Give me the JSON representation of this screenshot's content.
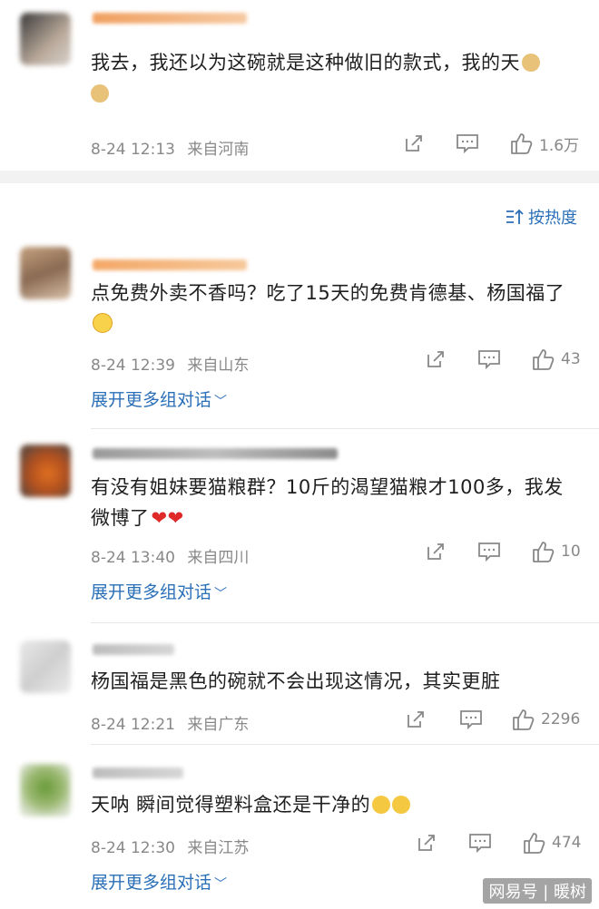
{
  "sort": {
    "label": "按热度"
  },
  "comments": [
    {
      "text": "我去，我还以为这碗就是这种做旧的款式，我的天",
      "time": "8-24 12:13",
      "location": "来自河南",
      "likes": "1.6万",
      "expand": ""
    },
    {
      "text": "点免费外卖不香吗？吃了15天的免费肯德基、杨国福了",
      "time": "8-24 12:39",
      "location": "来自山东",
      "likes": "43",
      "expand": "展开更多组对话"
    },
    {
      "text": "有没有姐妹要猫粮群？10斤的渴望猫粮才100多，我发微博了",
      "time": "8-24 13:40",
      "location": "来自四川",
      "likes": "10",
      "expand": "展开更多组对话"
    },
    {
      "text": "杨国福是黑色的碗就不会出现这情况，其实更脏",
      "time": "8-24 12:21",
      "location": "来自广东",
      "likes": "2296",
      "expand": ""
    },
    {
      "text": "天呐 瞬间觉得塑料盒还是干净的",
      "time": "8-24 12:30",
      "location": "来自江苏",
      "likes": "474",
      "expand": "展开更多组对话"
    }
  ],
  "icons": {
    "share": "share-icon",
    "comment": "comment-icon",
    "like": "like-icon",
    "sort": "sort-icon"
  },
  "colors": {
    "link": "#2a6fb8",
    "meta": "#888888",
    "band": "#f2f2f2"
  },
  "watermark": "网易号 | 暖树"
}
